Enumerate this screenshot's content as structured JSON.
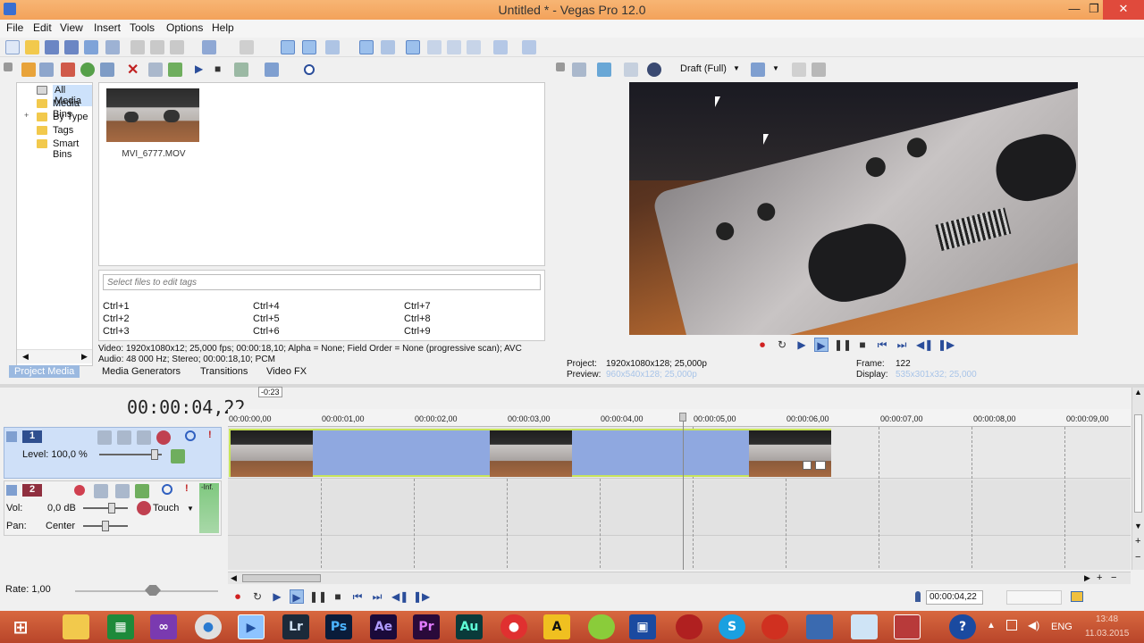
{
  "window": {
    "title": "Untitled * - Vegas Pro 12.0",
    "minimize": "—",
    "maximize": "❐",
    "close": "✕"
  },
  "menu": [
    "File",
    "Edit",
    "View",
    "Insert",
    "Tools",
    "Options",
    "Help"
  ],
  "tree": [
    "All Media",
    "Media Bins",
    "By Type",
    "Tags",
    "Smart Bins"
  ],
  "media_file": {
    "name": "MVI_6777.MOV"
  },
  "tags": {
    "placeholder": "Select files to edit tags",
    "shortcuts": [
      "Ctrl+1",
      "Ctrl+4",
      "Ctrl+7",
      "Ctrl+2",
      "Ctrl+5",
      "Ctrl+8",
      "Ctrl+3",
      "Ctrl+6",
      "Ctrl+9"
    ]
  },
  "media_info": {
    "video": "Video: 1920x1080x12; 25,000 fps; 00:00:18,10; Alpha = None; Field Order = None (progressive scan); AVC",
    "audio": "Audio: 48 000 Hz; Stereo; 00:00:18,10; PCM"
  },
  "bottom_tabs": [
    "Project Media",
    "Media Generators",
    "Transitions",
    "Video FX"
  ],
  "preview": {
    "quality": "Draft (Full)",
    "project_label": "Project:",
    "project_value": "1920x1080x128; 25,000p",
    "preview_label": "Preview:",
    "preview_value": "960x540x128; 25,000p",
    "frame_label": "Frame:",
    "frame_value": "122",
    "display_label": "Display:",
    "display_value": "535x301x32; 25,000"
  },
  "timeline": {
    "timecode": "00:00:04,22",
    "marker": "-0:23",
    "ruler": [
      "00:00:00,00",
      "00:00:01,00",
      "00:00:02,00",
      "00:00:03,00",
      "00:00:04,00",
      "00:00:05,00",
      "00:00:06,00",
      "00:00:07,00",
      "00:00:08,00",
      "00:00:09,00"
    ],
    "rate": "Rate: 1,00",
    "status_time": "00:00:04,22"
  },
  "tracks": {
    "video": {
      "number": "1",
      "level": "Level: 100,0 %"
    },
    "audio": {
      "number": "2",
      "vol_label": "Vol:",
      "vol_value": "0,0 dB",
      "pan_label": "Pan:",
      "pan_value": "Center",
      "mode": "Touch",
      "meter_top": "-Inf."
    }
  },
  "taskbar": {
    "apps": [
      "Lr",
      "Ps",
      "Ae",
      "Pr",
      "Au",
      "A"
    ],
    "lang": "ENG",
    "time": "13:48",
    "date": "11.03.2015"
  }
}
